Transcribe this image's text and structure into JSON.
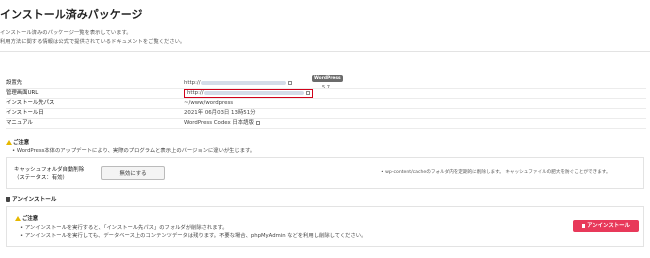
{
  "header": {
    "title": "インストール済みパッケージ",
    "description_line1": "インストール済みのパッケージ一覧を表示しています。",
    "description_line2": "利用方法に関する情報は公式で提供されているドキュメントをご覧ください。"
  },
  "package": {
    "badge": "WordPress",
    "version": "5.7"
  },
  "info_rows": [
    {
      "label": "設置先",
      "value": "http://"
    },
    {
      "label": "管理画面URL",
      "value": "http://"
    },
    {
      "label": "インストール先パス",
      "value": "~/www/wordpress"
    },
    {
      "label": "インストール日",
      "value": "2021年 06月03日 13時51分"
    },
    {
      "label": "マニュアル",
      "value": "WordPress Codex 日本語版"
    }
  ],
  "notice": {
    "title": "ご注意",
    "bullet": "WordPress本体のアップデートにより、実際のプログラムと表示上のバージョンに違いが生じます。"
  },
  "cache": {
    "label_line1": "キャッシュフォルダ自動削除",
    "label_line2": "（ステータス：有効）",
    "button": "無効にする",
    "note": "wp-content/cacheのフォルダ内を定期的に削除します。 キャッシュファイルの肥大を防ぐことができます。"
  },
  "uninstall": {
    "heading": "アンインストール",
    "caution_title": "ご注意",
    "bullet1": "アンインストールを実行すると、「インストール先パス」のフォルダが削除されます。",
    "bullet2": "アンインストールを実行しても、データベース上のコンテンツデータは残ります。不要な場合、phpMyAdmin などを利用し削除してください。",
    "button": "アンインストール"
  },
  "colors": {
    "link": "#1e73be",
    "highlight_border": "#d0021b",
    "uninstall_button": "#e8395a",
    "warning_icon": "#e6b800"
  }
}
